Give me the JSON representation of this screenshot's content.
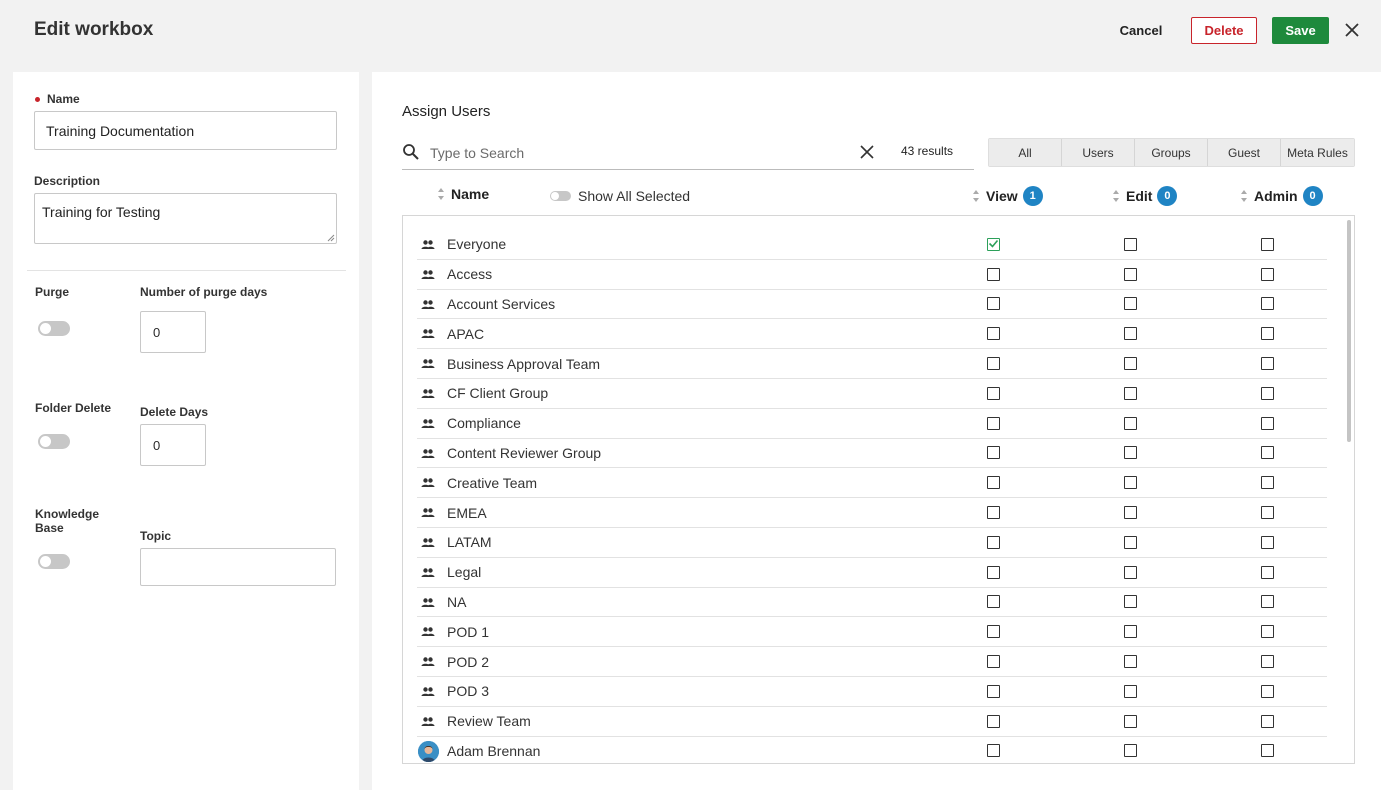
{
  "header": {
    "title": "Edit workbox",
    "cancel_label": "Cancel",
    "delete_label": "Delete",
    "save_label": "Save"
  },
  "form": {
    "name_label": "Name",
    "name_value": "Training Documentation",
    "description_label": "Description",
    "description_value": "Training for Testing",
    "purge_label": "Purge",
    "purge_days_label": "Number of purge days",
    "purge_days_value": "0",
    "folder_delete_label": "Folder Delete",
    "delete_days_label": "Delete Days",
    "delete_days_value": "0",
    "knowledge_base_label": "Knowledge Base",
    "topic_label": "Topic",
    "topic_value": ""
  },
  "assign": {
    "title": "Assign Users",
    "search_placeholder": "Type to Search",
    "results": "43 results",
    "filters": [
      "All",
      "Users",
      "Groups",
      "Guest",
      "Meta Rules"
    ],
    "show_all_selected": "Show All Selected",
    "columns": {
      "name": "Name",
      "view": "View",
      "view_count": "1",
      "edit": "Edit",
      "edit_count": "0",
      "admin": "Admin",
      "admin_count": "0"
    },
    "rows": [
      {
        "name": "Everyone",
        "type": "group",
        "view": true,
        "edit": false,
        "admin": false
      },
      {
        "name": "Access",
        "type": "group",
        "view": false,
        "edit": false,
        "admin": false
      },
      {
        "name": "Account Services",
        "type": "group",
        "view": false,
        "edit": false,
        "admin": false
      },
      {
        "name": "APAC",
        "type": "group",
        "view": false,
        "edit": false,
        "admin": false
      },
      {
        "name": "Business Approval Team",
        "type": "group",
        "view": false,
        "edit": false,
        "admin": false
      },
      {
        "name": "CF Client Group",
        "type": "group",
        "view": false,
        "edit": false,
        "admin": false
      },
      {
        "name": "Compliance",
        "type": "group",
        "view": false,
        "edit": false,
        "admin": false
      },
      {
        "name": "Content Reviewer Group",
        "type": "group",
        "view": false,
        "edit": false,
        "admin": false
      },
      {
        "name": "Creative Team",
        "type": "group",
        "view": false,
        "edit": false,
        "admin": false
      },
      {
        "name": "EMEA",
        "type": "group",
        "view": false,
        "edit": false,
        "admin": false
      },
      {
        "name": "LATAM",
        "type": "group",
        "view": false,
        "edit": false,
        "admin": false
      },
      {
        "name": "Legal",
        "type": "group",
        "view": false,
        "edit": false,
        "admin": false
      },
      {
        "name": "NA",
        "type": "group",
        "view": false,
        "edit": false,
        "admin": false
      },
      {
        "name": "POD 1",
        "type": "group",
        "view": false,
        "edit": false,
        "admin": false
      },
      {
        "name": "POD 2",
        "type": "group",
        "view": false,
        "edit": false,
        "admin": false
      },
      {
        "name": "POD 3",
        "type": "group",
        "view": false,
        "edit": false,
        "admin": false
      },
      {
        "name": "Review Team",
        "type": "group",
        "view": false,
        "edit": false,
        "admin": false
      },
      {
        "name": "Adam Brennan",
        "type": "user",
        "view": false,
        "edit": false,
        "admin": false
      }
    ]
  },
  "colors": {
    "accent_green": "#1e8a3c",
    "delete_red": "#c8242b",
    "badge_blue": "#1f84c4",
    "checked_green": "#2ca05a"
  }
}
